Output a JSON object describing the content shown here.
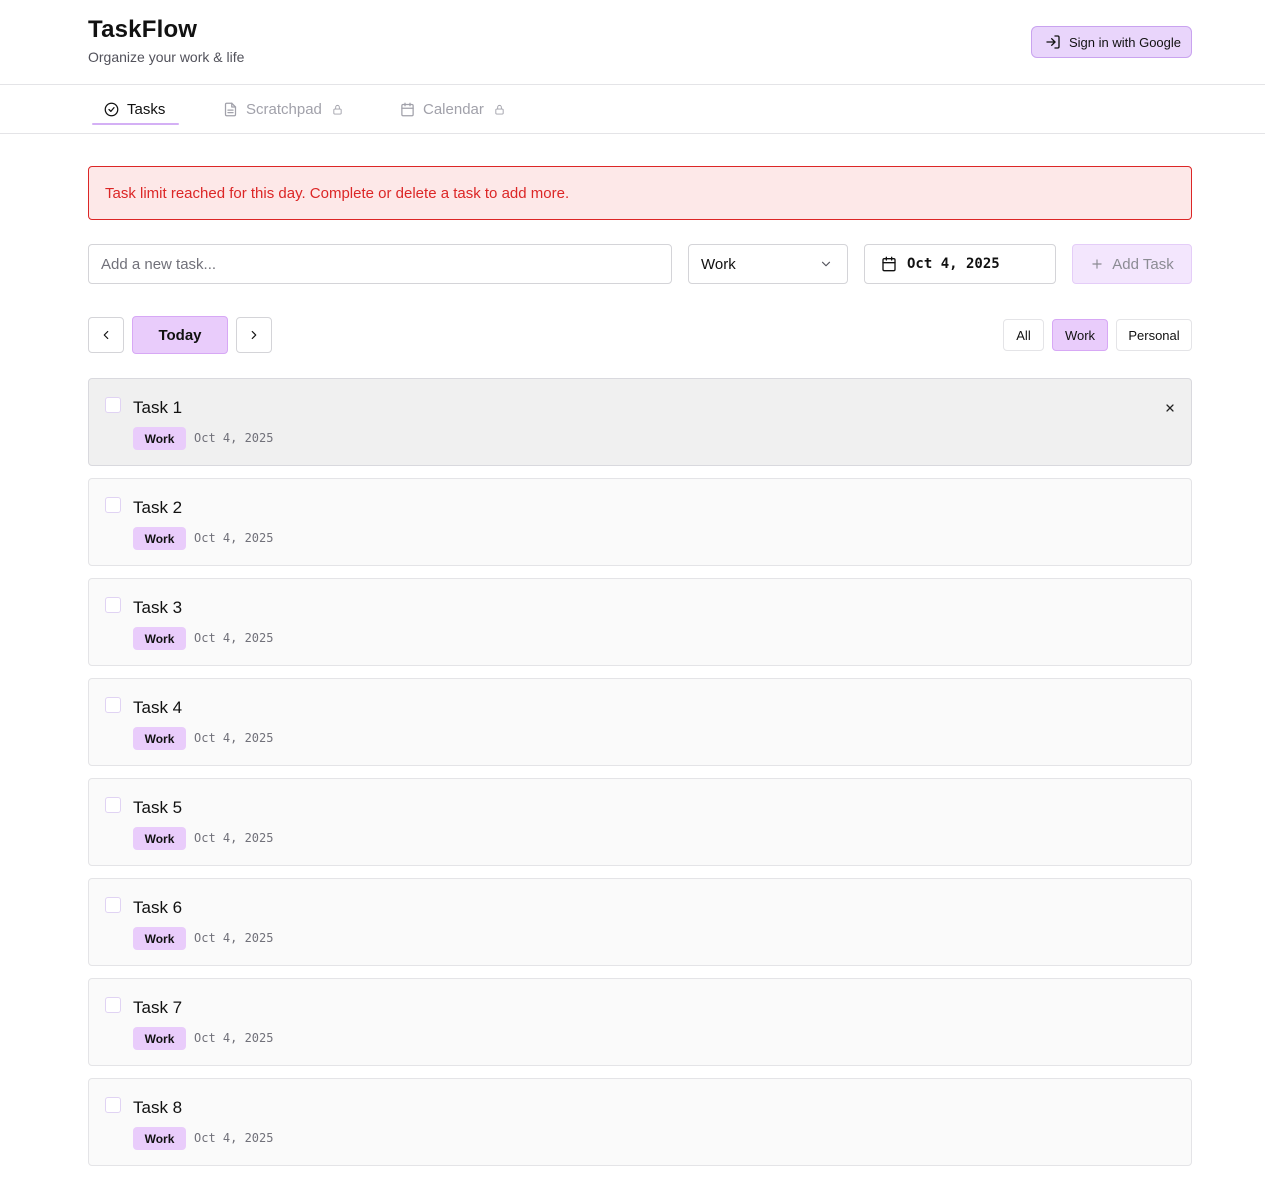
{
  "app": {
    "title": "TaskFlow",
    "subtitle": "Organize your work & life",
    "signin_label": "Sign in with Google"
  },
  "tabs": [
    {
      "label": "Tasks",
      "icon": "check-circle-icon",
      "active": true,
      "locked": false
    },
    {
      "label": "Scratchpad",
      "icon": "document-icon",
      "active": false,
      "locked": true
    },
    {
      "label": "Calendar",
      "icon": "calendar-icon",
      "active": false,
      "locked": true
    }
  ],
  "alert": {
    "message": "Task limit reached for this day. Complete or delete a task to add more.",
    "color": "#dc2626"
  },
  "composer": {
    "placeholder": "Add a new task...",
    "category": "Work",
    "date": "Oct 4, 2025",
    "add_label": "Add Task"
  },
  "date_nav": {
    "today_label": "Today"
  },
  "filters": {
    "all": "All",
    "work": "Work",
    "personal": "Personal",
    "selected": "Work"
  },
  "tasks": [
    {
      "title": "Task 1",
      "category": "Work",
      "date": "Oct 4, 2025"
    },
    {
      "title": "Task 2",
      "category": "Work",
      "date": "Oct 4, 2025"
    },
    {
      "title": "Task 3",
      "category": "Work",
      "date": "Oct 4, 2025"
    },
    {
      "title": "Task 4",
      "category": "Work",
      "date": "Oct 4, 2025"
    },
    {
      "title": "Task 5",
      "category": "Work",
      "date": "Oct 4, 2025"
    },
    {
      "title": "Task 6",
      "category": "Work",
      "date": "Oct 4, 2025"
    },
    {
      "title": "Task 7",
      "category": "Work",
      "date": "Oct 4, 2025"
    },
    {
      "title": "Task 8",
      "category": "Work",
      "date": "Oct 4, 2025"
    }
  ],
  "colors": {
    "accent": "#e9ccfb",
    "accent_border": "#d7a8f5",
    "error": "#dc2626"
  }
}
